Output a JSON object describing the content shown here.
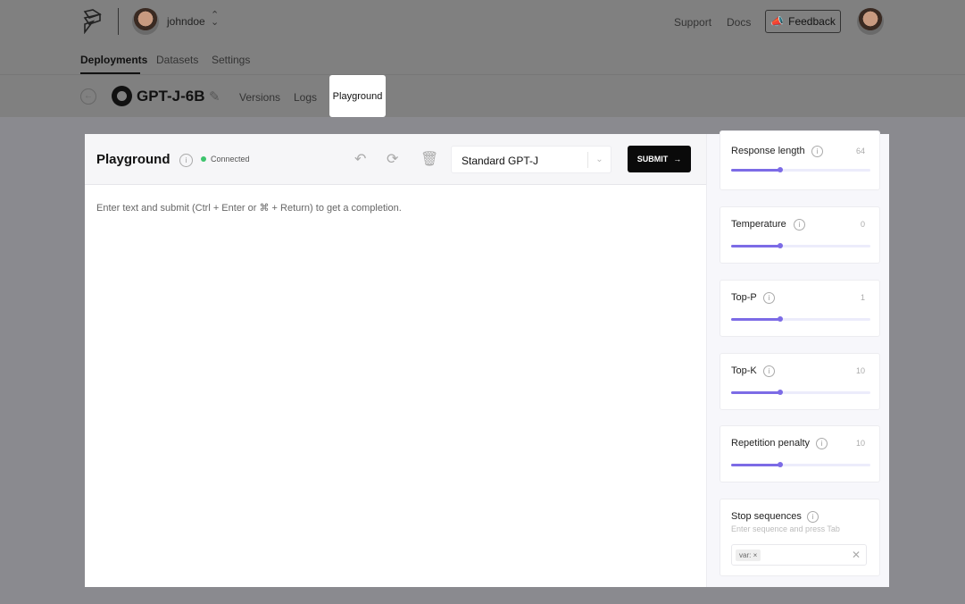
{
  "header": {
    "username": "johndoe",
    "links": [
      "Support",
      "Docs"
    ],
    "feedback": "Feedback"
  },
  "nav": {
    "tabs": [
      "Deployments",
      "Datasets",
      "Settings"
    ]
  },
  "model": {
    "name": "GPT-J-6B",
    "tabs": [
      "Versions",
      "Logs",
      "Playground"
    ]
  },
  "playground": {
    "title": "Playground",
    "status": "Connected",
    "model_select": "Standard GPT-J",
    "submit": "SUBMIT",
    "placeholder": "Enter text and submit (Ctrl + Enter or ⌘ + Return) to get a completion."
  },
  "params": [
    {
      "label": "Response length",
      "value": "64",
      "fill": 0.35
    },
    {
      "label": "Temperature",
      "value": "0",
      "fill": 0.35
    },
    {
      "label": "Top-P",
      "value": "1",
      "fill": 0.35
    },
    {
      "label": "Top-K",
      "value": "10",
      "fill": 0.35
    },
    {
      "label": "Repetition penalty",
      "value": "10",
      "fill": 0.35
    }
  ],
  "stop": {
    "label": "Stop sequences",
    "hint": "Enter sequence and press Tab",
    "chips": [
      "var:"
    ]
  },
  "colors": {
    "accent": "#7c6be6",
    "connected": "#3ec46d"
  }
}
